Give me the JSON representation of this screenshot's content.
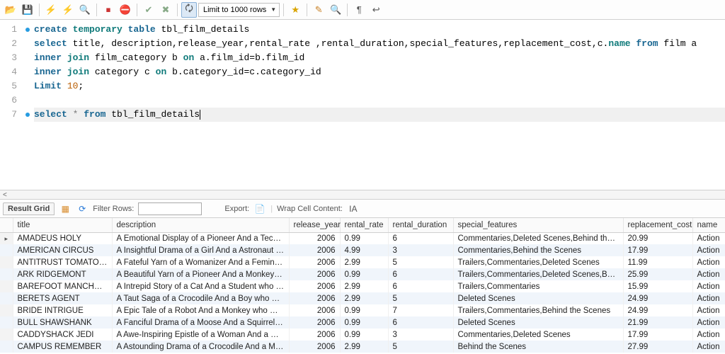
{
  "toolbar": {
    "limit_label": "Limit to 1000 rows"
  },
  "sql": {
    "lines": [
      "1",
      "2",
      "3",
      "4",
      "5",
      "6",
      "7"
    ],
    "l1_create": "create ",
    "l1_temporary": "temporary ",
    "l1_table": "table ",
    "l1_ident": "tbl_film_details",
    "l2_select": "select ",
    "l2_cols": "title, description,release_year,rental_rate ,rental_duration,special_features,replacement_cost,c.",
    "l2_name": "name ",
    "l2_from": "from ",
    "l2_tab": "film a",
    "l3_inner": "inner ",
    "l3_join": "join ",
    "l3_rest": "film_category b ",
    "l3_on": "on ",
    "l3_cond": "a.film_id=b.film_id",
    "l4_inner": "inner ",
    "l4_join": "join ",
    "l4_rest": "category c ",
    "l4_on": "on ",
    "l4_cond": "b.category_id=c.category_id",
    "l5_limit": "Limit ",
    "l5_num": "10",
    "l5_semi": ";",
    "l7_select": "select ",
    "l7_star": "* ",
    "l7_from": "from ",
    "l7_ident": "tbl_film_details"
  },
  "divider_hint": "<",
  "results": {
    "tab": "Result Grid",
    "filter_label": "Filter Rows:",
    "filter_value": "",
    "export_label": "Export:",
    "wrap_label": "Wrap Cell Content:",
    "columns": {
      "title": "title",
      "description": "description",
      "release_year": "release_year",
      "rental_rate": "rental_rate",
      "rental_duration": "rental_duration",
      "special_features": "special_features",
      "replacement_cost": "replacement_cost",
      "name": "name"
    },
    "rows": [
      {
        "title": "AMADEUS HOLY",
        "description": "A Emotional Display of a Pioneer And a Technica...",
        "release_year": "2006",
        "rental_rate": "0.99",
        "rental_duration": "6",
        "special_features": "Commentaries,Deleted Scenes,Behind the Scenes",
        "replacement_cost": "20.99",
        "name": "Action"
      },
      {
        "title": "AMERICAN CIRCUS",
        "description": "A Insightful Drama of a Girl And a Astronaut wh...",
        "release_year": "2006",
        "rental_rate": "4.99",
        "rental_duration": "3",
        "special_features": "Commentaries,Behind the Scenes",
        "replacement_cost": "17.99",
        "name": "Action"
      },
      {
        "title": "ANTITRUST TOMATOES",
        "description": "A Fateful Yarn of a Womanizer And a Feminist ...",
        "release_year": "2006",
        "rental_rate": "2.99",
        "rental_duration": "5",
        "special_features": "Trailers,Commentaries,Deleted Scenes",
        "replacement_cost": "11.99",
        "name": "Action"
      },
      {
        "title": "ARK RIDGEMONT",
        "description": "A Beautiful Yarn of a Pioneer And a Monkey wh...",
        "release_year": "2006",
        "rental_rate": "0.99",
        "rental_duration": "6",
        "special_features": "Trailers,Commentaries,Deleted Scenes,Behind t...",
        "replacement_cost": "25.99",
        "name": "Action"
      },
      {
        "title": "BAREFOOT MANCHURIAN",
        "description": "A Intrepid Story of a Cat And a Student who m...",
        "release_year": "2006",
        "rental_rate": "2.99",
        "rental_duration": "6",
        "special_features": "Trailers,Commentaries",
        "replacement_cost": "15.99",
        "name": "Action"
      },
      {
        "title": "BERETS AGENT",
        "description": "A Taut Saga of a Crocodile And a Boy who must...",
        "release_year": "2006",
        "rental_rate": "2.99",
        "rental_duration": "5",
        "special_features": "Deleted Scenes",
        "replacement_cost": "24.99",
        "name": "Action"
      },
      {
        "title": "BRIDE INTRIGUE",
        "description": "A Epic Tale of a Robot And a Monkey who must ...",
        "release_year": "2006",
        "rental_rate": "0.99",
        "rental_duration": "7",
        "special_features": "Trailers,Commentaries,Behind the Scenes",
        "replacement_cost": "24.99",
        "name": "Action"
      },
      {
        "title": "BULL SHAWSHANK",
        "description": "A Fanciful Drama of a Moose And a Squirrel who...",
        "release_year": "2006",
        "rental_rate": "0.99",
        "rental_duration": "6",
        "special_features": "Deleted Scenes",
        "replacement_cost": "21.99",
        "name": "Action"
      },
      {
        "title": "CADDYSHACK JEDI",
        "description": "A Awe-Inspiring Epistle of a Woman And a Mad...",
        "release_year": "2006",
        "rental_rate": "0.99",
        "rental_duration": "3",
        "special_features": "Commentaries,Deleted Scenes",
        "replacement_cost": "17.99",
        "name": "Action"
      },
      {
        "title": "CAMPUS REMEMBER",
        "description": "A Astounding Drama of a Crocodile And a Mad ...",
        "release_year": "2006",
        "rental_rate": "2.99",
        "rental_duration": "5",
        "special_features": "Behind the Scenes",
        "replacement_cost": "27.99",
        "name": "Action"
      }
    ]
  }
}
